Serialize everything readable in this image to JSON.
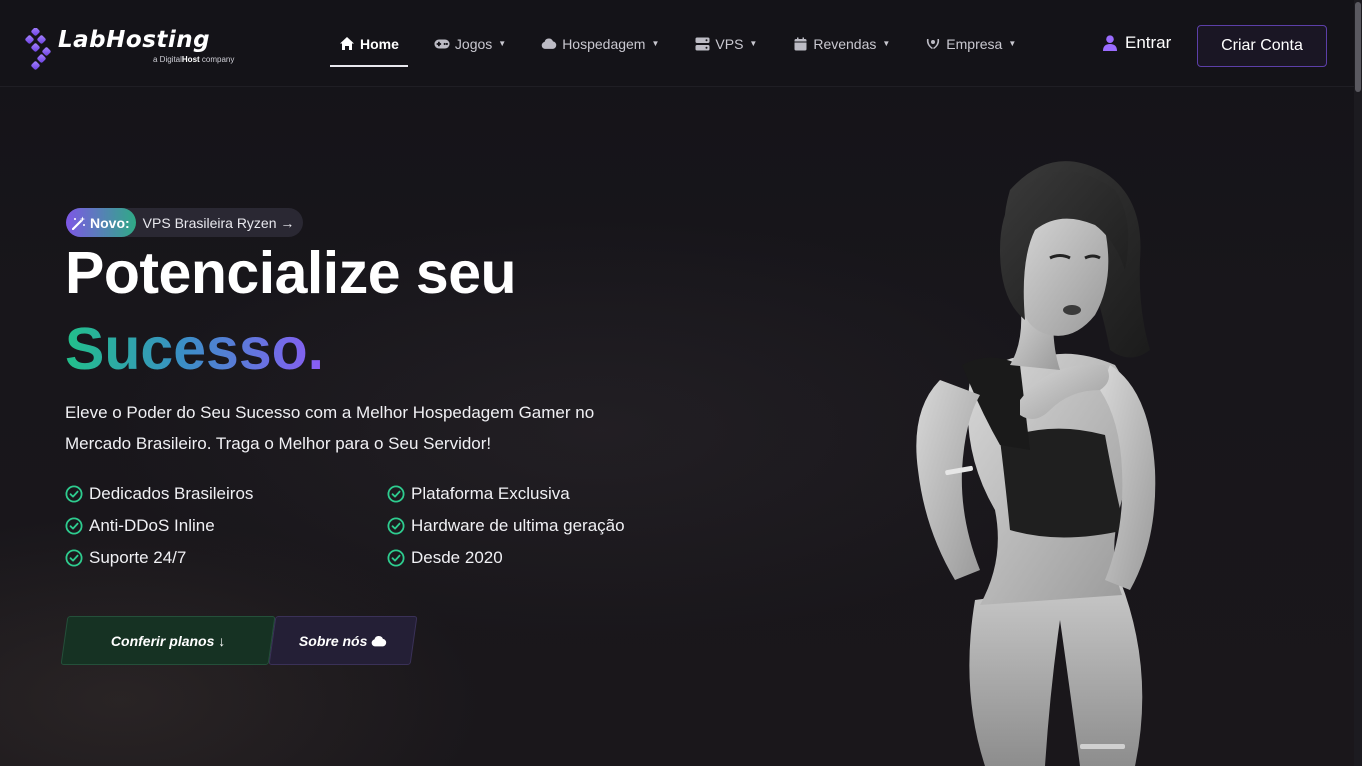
{
  "brand": {
    "name": "LabHosting",
    "sub_prefix": "a Digital",
    "sub_bold": "Host",
    "sub_suffix": " company",
    "accent": "#8b5cf6",
    "green": "#22c08a"
  },
  "nav": {
    "items": [
      {
        "label": "Home",
        "icon": "home-icon",
        "active": true
      },
      {
        "label": "Jogos",
        "icon": "gamepad-icon",
        "dropdown": true
      },
      {
        "label": "Hospedagem",
        "icon": "cloud-icon",
        "dropdown": true
      },
      {
        "label": "VPS",
        "icon": "server-icon",
        "dropdown": true
      },
      {
        "label": "Revendas",
        "icon": "calendar-icon",
        "dropdown": true
      },
      {
        "label": "Empresa",
        "icon": "laurel-icon",
        "dropdown": true
      }
    ],
    "login_label": "Entrar",
    "signup_label": "Criar Conta"
  },
  "hero": {
    "badge_label": "Novo:",
    "badge_text": "VPS Brasileira Ryzen",
    "title_line1": "Potencialize seu",
    "title_line2": "Sucesso.",
    "description": "Eleve o Poder do Seu Sucesso com a Melhor Hospedagem Gamer no Mercado Brasileiro. Traga o Melhor para o Seu Servidor!",
    "features": [
      "Dedicados Brasileiros",
      "Plataforma Exclusiva",
      "Anti-DDoS Inline",
      "Hardware de ultima geração",
      "Suporte 24/7",
      "Desde 2020"
    ],
    "cta_primary": "Conferir planos",
    "cta_secondary": "Sobre nós"
  }
}
